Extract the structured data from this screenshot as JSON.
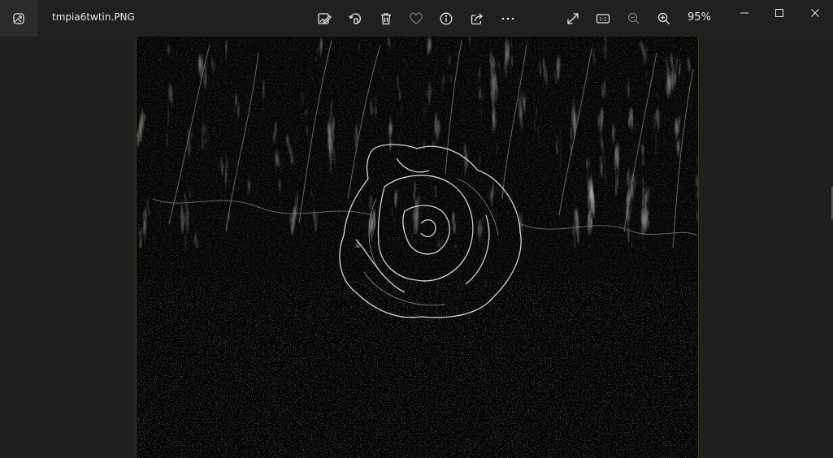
{
  "window": {
    "file_name": "tmpia6twtin.PNG",
    "zoom": "95%"
  },
  "toolbar": {
    "items": [
      {
        "id": "edit",
        "icon": "edit-image-icon"
      },
      {
        "id": "rotate",
        "icon": "rotate-icon"
      },
      {
        "id": "delete",
        "icon": "trash-icon"
      },
      {
        "id": "favorite",
        "icon": "heart-icon"
      },
      {
        "id": "info",
        "icon": "info-icon"
      },
      {
        "id": "share",
        "icon": "share-icon"
      },
      {
        "id": "more",
        "icon": "more-icon"
      },
      {
        "id": "fullscreen",
        "icon": "expand-icon"
      },
      {
        "id": "actual-size",
        "icon": "actual-size-icon",
        "label": "1:1"
      },
      {
        "id": "zoom-out",
        "icon": "zoom-out-icon"
      },
      {
        "id": "zoom-in",
        "icon": "zoom-in-icon"
      }
    ]
  },
  "colors": {
    "titlebar_bg": "#202020",
    "canvas_bg": "#1f1f1f",
    "icon": "#e6e6e6",
    "icon_disabled": "#7a7a7a",
    "photo_edge": "#d8e0ea"
  }
}
